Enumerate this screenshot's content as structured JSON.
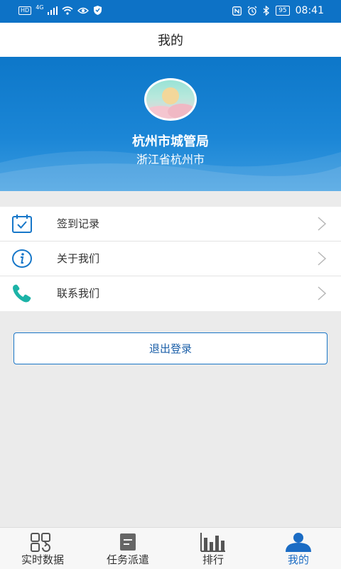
{
  "status_bar": {
    "hd": "HD",
    "network": "4G",
    "battery": "95",
    "time": "08:41"
  },
  "title": "我的",
  "profile": {
    "org_name": "杭州市城管局",
    "region": "浙江省杭州市"
  },
  "menu": [
    {
      "label": "签到记录",
      "icon": "calendar-check-icon"
    },
    {
      "label": "关于我们",
      "icon": "info-icon"
    },
    {
      "label": "联系我们",
      "icon": "phone-icon"
    }
  ],
  "logout_label": "退出登录",
  "tabs": [
    {
      "label": "实时数据",
      "icon": "grid-refresh-icon"
    },
    {
      "label": "任务派遣",
      "icon": "document-icon"
    },
    {
      "label": "排行",
      "icon": "bar-chart-icon"
    },
    {
      "label": "我的",
      "icon": "user-icon",
      "active": true
    }
  ],
  "colors": {
    "primary": "#0d72c6",
    "accent_text": "#1b6cc4",
    "icon_teal": "#1cb3a7"
  }
}
